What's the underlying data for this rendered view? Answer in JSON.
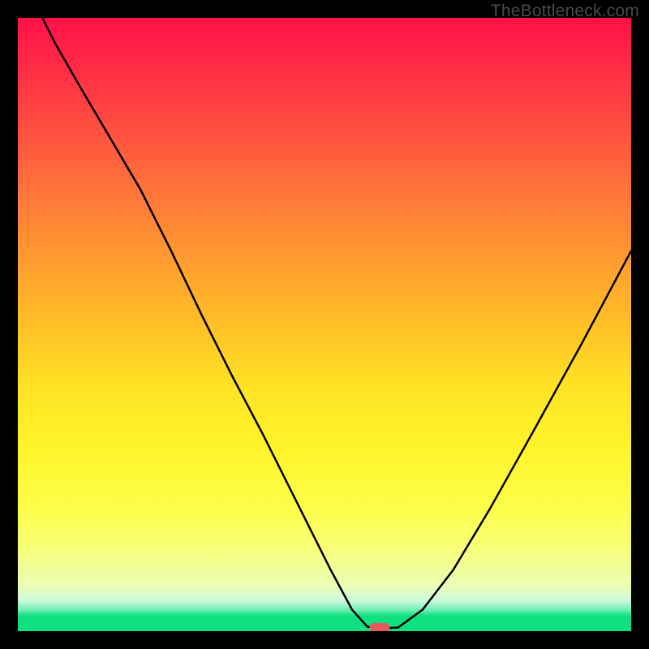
{
  "watermark": "TheBottleneck.com",
  "chart_data": {
    "type": "line",
    "title": "",
    "xlabel": "",
    "ylabel": "",
    "xlim": [
      0,
      100
    ],
    "ylim": [
      0,
      100
    ],
    "grid": false,
    "series": [
      {
        "name": "curve",
        "x": [
          4,
          6,
          10,
          15,
          20,
          22,
          25,
          30,
          35,
          40,
          45,
          48,
          51,
          54.5,
          57,
          60,
          62,
          66,
          71,
          77,
          84,
          92,
          100
        ],
        "y": [
          100,
          96,
          89,
          80.5,
          72,
          68,
          62,
          51.5,
          41.5,
          32,
          22,
          16,
          10,
          3.5,
          0.7,
          0.5,
          0.6,
          3.5,
          10,
          20,
          32.5,
          47,
          62
        ]
      }
    ],
    "marker": {
      "x": 59,
      "y": 0.5,
      "color": "#e45a5a"
    }
  }
}
